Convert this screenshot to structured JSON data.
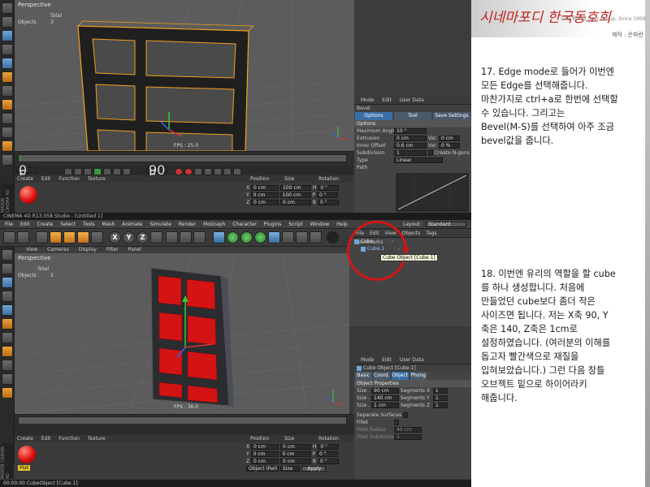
{
  "top_screenshot": {
    "viewport": {
      "view_label": "Perspective",
      "stats": {
        "label1": "Total",
        "label2": "Objects",
        "value2": "3"
      },
      "fps": "FPS : 25.0"
    },
    "timeline": {
      "frame_start": "0 F",
      "frame_end": "90 F"
    },
    "attributes": {
      "menu": [
        "Mode",
        "Edit",
        "User Data"
      ],
      "tool_name": "Bevel",
      "tabs": [
        "Options",
        "Tool",
        "Save Settings"
      ],
      "section": "Options",
      "rows": [
        {
          "label": "Maximum Angle",
          "value": "10 °"
        },
        {
          "label": "Extrusion",
          "value": "0 cm",
          "label2": "Var.",
          "value2": "0 cm"
        },
        {
          "label": "Inner Offset",
          "value": "0.6 cm",
          "label2": "Var.",
          "value2": "0 %"
        },
        {
          "label": "Subdivision",
          "value": "1",
          "label2": "Create N-gons",
          "value2": ""
        },
        {
          "label": "Type",
          "value": "Linear"
        },
        {
          "label": "Path",
          "value": ""
        }
      ]
    },
    "bottom": {
      "menu": [
        "Create",
        "Edit",
        "Function",
        "Texture"
      ],
      "coords_headers": [
        "Position",
        "Size",
        "Rotation"
      ],
      "coords_rows": [
        {
          "axis": "X",
          "pos": "0 cm",
          "size": "100 cm",
          "rot": "H",
          "rotval": "0 °"
        },
        {
          "axis": "Y",
          "pos": "0 cm",
          "size": "100 cm",
          "rot": "P",
          "rotval": "0 °"
        },
        {
          "axis": "Z",
          "pos": "0 cm",
          "size": "0 cm",
          "rot": "B",
          "rotval": "0 °"
        }
      ],
      "maxon": "MAXON CINEMA 4D"
    }
  },
  "second_screenshot": {
    "window_title": "CINEMA 4D R13.058 Studio - [Untitled 1]",
    "main_menu": [
      "File",
      "Edit",
      "Create",
      "Select",
      "Tools",
      "Mesh",
      "Animate",
      "Simulate",
      "Render",
      "MoGraph",
      "Character",
      "Plugins",
      "Script",
      "Window",
      "Help"
    ],
    "layout_label": "Layout:",
    "layout_value": "Standard",
    "viewport_menu": [
      "View",
      "Cameras",
      "Display",
      "Filter",
      "Panel"
    ],
    "viewport": {
      "view_label": "Perspective",
      "stats": {
        "label1": "Total",
        "label2": "Objects",
        "value2": "2"
      },
      "fps": "FPS : 36.0"
    },
    "objects_menu": [
      "File",
      "Edit",
      "View",
      "Objects",
      "Tags",
      "Bookmarks"
    ],
    "objects": [
      {
        "name": "Cube",
        "selected": false
      },
      {
        "name": "Cube.1",
        "selected": true
      }
    ],
    "tooltip": "Cube Object [Cube.1]",
    "attributes": {
      "menu": [
        "Mode",
        "Edit",
        "User Data"
      ],
      "object_title": "Cube Object [Cube.1]",
      "tabs": [
        "Basic",
        "Coord.",
        "Object",
        "Phong"
      ],
      "section": "Object Properties",
      "sizes": [
        {
          "label": "Size . X",
          "value": "90 cm",
          "seg": "Segments X",
          "segval": "1"
        },
        {
          "label": "Size . Y",
          "value": "140 cm",
          "seg": "Segments Y",
          "segval": "1"
        },
        {
          "label": "Size . Z",
          "value": "1 cm",
          "seg": "Segments Z",
          "segval": "1"
        }
      ],
      "extra": [
        "Separate Surfaces",
        "Fillet",
        "Fillet Radius",
        "Fillet Subdivision"
      ],
      "extra_values": [
        "",
        "",
        "40 cm",
        "5"
      ]
    },
    "bottom": {
      "menu": [
        "Create",
        "Edit",
        "Function",
        "Texture"
      ],
      "material_name": "Mat",
      "coords_headers": [
        "Position",
        "Size",
        "Rotation"
      ],
      "coords_rows": [
        {
          "axis": "X",
          "pos": "0 cm",
          "size": "0 cm",
          "rot": "H",
          "rotval": "0 °"
        },
        {
          "axis": "Y",
          "pos": "0 cm",
          "size": "0 cm",
          "rot": "P",
          "rotval": "0 °"
        },
        {
          "axis": "Z",
          "pos": "0 cm",
          "size": "0 cm",
          "rot": "B",
          "rotval": "0 °"
        }
      ],
      "coord_mode": "Object (Rel)",
      "size_mode": "Size",
      "apply": "Apply",
      "maxon": "MAXON CINEMA 4D"
    },
    "status_bar": "00:00:00   CubeObject [Cube.1]"
  },
  "right_column": {
    "banner_title": "시네마포디 한국동호회",
    "banner_subtitle": "C4D Korea User Group, Since 1999",
    "credit": "제작 : 은파란",
    "step17": "17. Edge mode로 들어가 이번엔\n모든 Edge를 선택해줍니다.\n마찬가지로 ctrl+a로 한번에 선택할\n수 있습니다. 그리고는\nBevel(M-S)를 선택하여 아주 조금\nbevel값을 줍니다.",
    "step18": "18. 이번엔 유리의 역할을 할 cube\n를 하나 생성합니다. 처음에\n만들었던 cube보다 좀더 작은\n사이즈면 됩니다. 저는 X축 90, Y\n축은 140, Z축은 1cm로\n설정하였습니다. (여러분의 이해를\n돕고자 빨간색으로 재질을\n입혀보았습니다.) 그런 다음 창틀\n오브젝트 밑으로 하이어라키\n해줍니다."
  }
}
